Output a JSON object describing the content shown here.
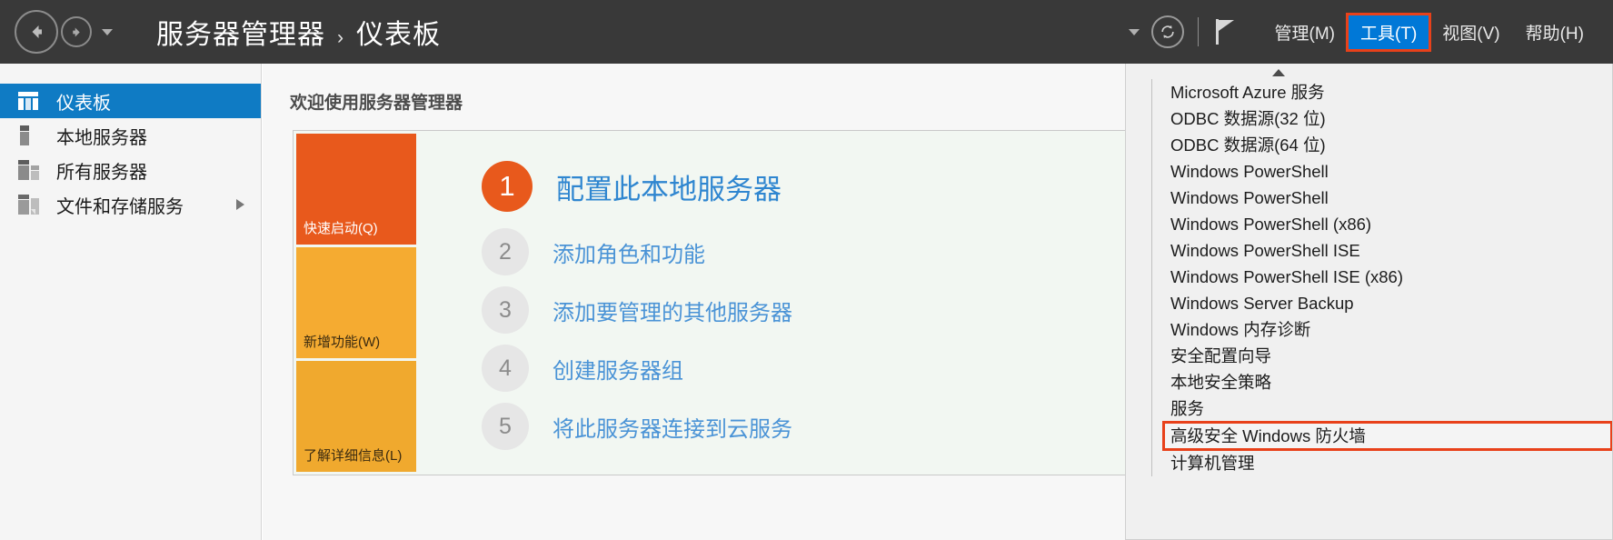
{
  "titlebar": {
    "back_icon": "arrow-left-icon",
    "forward_icon": "arrow-right-icon",
    "history_caret": "chevron-down-icon",
    "breadcrumb": {
      "root": "服务器管理器",
      "separator": "›",
      "current": "仪表板"
    },
    "right": {
      "caret": "chevron-down-icon",
      "refresh_icon": "refresh-icon",
      "flag_icon": "flag-icon",
      "menus": [
        {
          "label": "管理(M)",
          "active": false
        },
        {
          "label": "工具(T)",
          "active": true
        },
        {
          "label": "视图(V)",
          "active": false
        },
        {
          "label": "帮助(H)",
          "active": false
        }
      ]
    }
  },
  "sidebar": {
    "items": [
      {
        "label": "仪表板",
        "icon": "dashboard-grid-icon",
        "selected": true,
        "expandable": false
      },
      {
        "label": "本地服务器",
        "icon": "server-icon",
        "selected": false,
        "expandable": false
      },
      {
        "label": "所有服务器",
        "icon": "servers-stack-icon",
        "selected": false,
        "expandable": false
      },
      {
        "label": "文件和存储服务",
        "icon": "file-storage-icon",
        "selected": false,
        "expandable": true
      }
    ]
  },
  "content": {
    "welcome_title": "欢迎使用服务器管理器",
    "tiles": [
      {
        "label": "快速启动(Q)",
        "color": "#e8591c"
      },
      {
        "label": "新增功能(W)",
        "color": "#f5ab31"
      },
      {
        "label": "了解详细信息(L)",
        "color": "#f0a92e"
      }
    ],
    "steps": [
      {
        "number": "1",
        "label": "配置此本地服务器",
        "primary": true
      },
      {
        "number": "2",
        "label": "添加角色和功能",
        "primary": false
      },
      {
        "number": "3",
        "label": "添加要管理的其他服务器",
        "primary": false
      },
      {
        "number": "4",
        "label": "创建服务器组",
        "primary": false
      },
      {
        "number": "5",
        "label": "将此服务器连接到云服务",
        "primary": false
      }
    ]
  },
  "tools_menu": {
    "pointer_icon": "caret-up-icon",
    "highlight_color": "#e8411a",
    "items": [
      {
        "label": "Microsoft Azure 服务",
        "highlighted": false
      },
      {
        "label": "ODBC 数据源(32 位)",
        "highlighted": false
      },
      {
        "label": "ODBC 数据源(64 位)",
        "highlighted": false
      },
      {
        "label": "Windows PowerShell",
        "highlighted": false
      },
      {
        "label": "Windows PowerShell",
        "highlighted": false
      },
      {
        "label": "Windows PowerShell (x86)",
        "highlighted": false
      },
      {
        "label": "Windows PowerShell ISE",
        "highlighted": false
      },
      {
        "label": "Windows PowerShell ISE (x86)",
        "highlighted": false
      },
      {
        "label": "Windows Server Backup",
        "highlighted": false
      },
      {
        "label": "Windows 内存诊断",
        "highlighted": false
      },
      {
        "label": "安全配置向导",
        "highlighted": false
      },
      {
        "label": "本地安全策略",
        "highlighted": false
      },
      {
        "label": "服务",
        "highlighted": false
      },
      {
        "label": "高级安全 Windows 防火墙",
        "highlighted": true
      },
      {
        "label": "计算机管理",
        "highlighted": false
      }
    ]
  }
}
